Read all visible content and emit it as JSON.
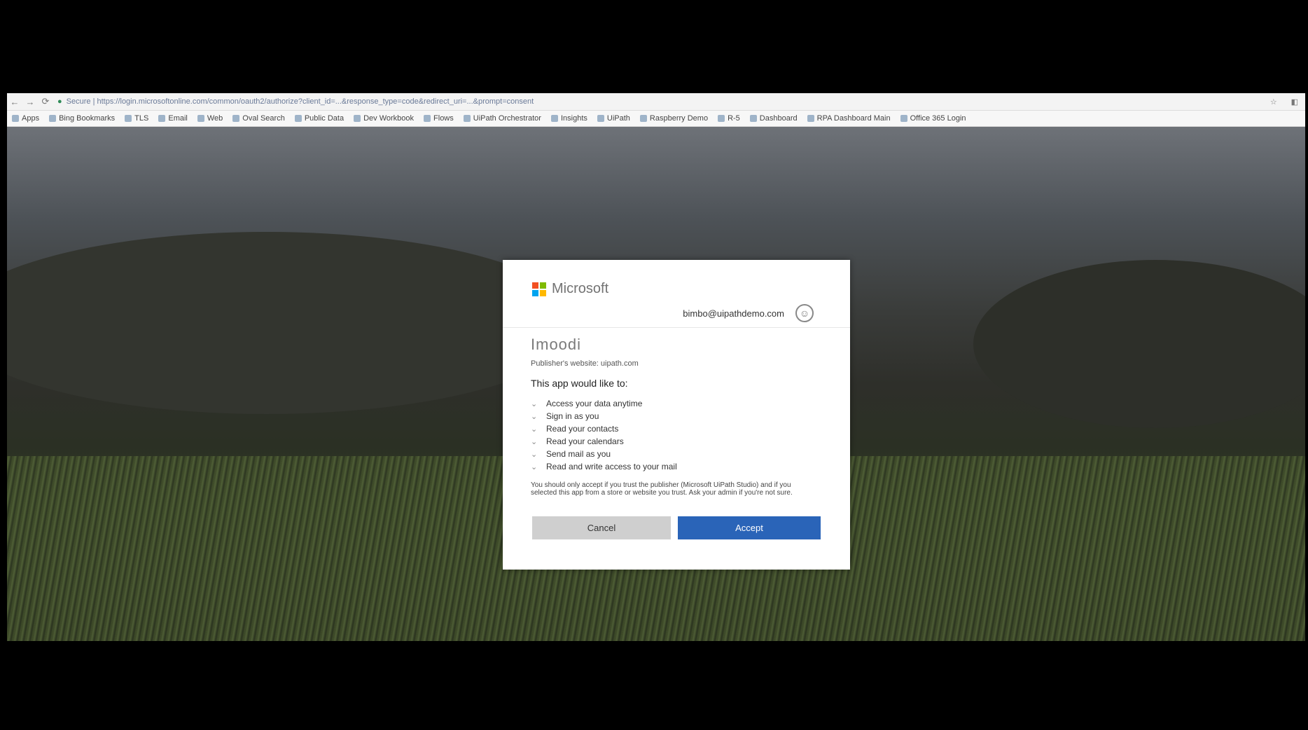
{
  "browser": {
    "url": "Secure | https://login.microsoftonline.com/common/oauth2/authorize?client_id=...&response_type=code&redirect_uri=...&prompt=consent",
    "bookmarks": [
      "Apps",
      "Bing Bookmarks",
      "TLS",
      "Email",
      "Web",
      "Oval Search",
      "Public Data",
      "Dev Workbook",
      "Flows",
      "UiPath Orchestrator",
      "Insights",
      "UiPath",
      "Raspberry Demo",
      "R-5",
      "Dashboard",
      "RPA Dashboard Main",
      "Office 365 Login"
    ]
  },
  "dialog": {
    "brand": "Microsoft",
    "account_email": "bimbo@uipathdemo.com",
    "app_name": "Imoodi",
    "publisher": "Publisher's website: uipath.com",
    "section_title": "This app would like to:",
    "permissions": [
      "Access your data anytime",
      "Sign in as you",
      "Read your contacts",
      "Read your calendars",
      "Send mail as you",
      "Read and write access to your mail"
    ],
    "disclaimer": "You should only accept if you trust the publisher (Microsoft UiPath Studio) and if you selected this app from a store or website you trust. Ask your admin if you're not sure.",
    "cancel_label": "Cancel",
    "accept_label": "Accept"
  },
  "colors": {
    "accept_button": "#2a64b8",
    "cancel_button": "#cfcfcf",
    "ms_red": "#f25022",
    "ms_green": "#7fba00",
    "ms_blue": "#00a4ef",
    "ms_yellow": "#ffb900"
  }
}
